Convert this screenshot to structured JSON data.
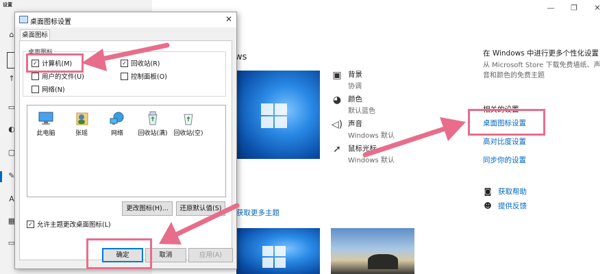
{
  "app": {
    "title": "设置"
  },
  "window_controls": {
    "minimize": "—",
    "maximize": "❐",
    "close": "✕"
  },
  "sidebar": {
    "icons": [
      "home-icon",
      "search-icon",
      "back-icon",
      "background-icon",
      "colors-icon",
      "lockscreen-icon",
      "themes-icon",
      "fonts-icon",
      "start-icon",
      "taskbar-icon"
    ]
  },
  "main": {
    "heading_partial": "ws",
    "themes": [
      {
        "icon": "picture-icon",
        "name": "背景",
        "value": "协调"
      },
      {
        "icon": "palette-icon",
        "name": "颜色",
        "value": "默认蓝色"
      },
      {
        "icon": "volume-icon",
        "name": "声音",
        "value": "Windows 默认"
      },
      {
        "icon": "cursor-icon",
        "name": "鼠标光标",
        "value": "Windows 默认"
      }
    ],
    "store_link_partial": "获取更多主题"
  },
  "right_panel": {
    "heading": "在 Windows 中进行更多个性化设置",
    "description": "从 Microsoft Store 下载免费墙纸、声音和颜色的免费主题",
    "related_heading": "相关的设置",
    "links": [
      "桌面图标设置",
      "高对比度设置",
      "同步你的设置"
    ],
    "help": [
      {
        "icon": "help-chat-icon",
        "label": "获取帮助"
      },
      {
        "icon": "feedback-icon",
        "label": "提供反馈"
      }
    ]
  },
  "dialog": {
    "title": "桌面图标设置",
    "tab": "桌面图标",
    "group_label": "桌面图标",
    "checkboxes": [
      {
        "label": "计算机(M)",
        "checked": true
      },
      {
        "label": "回收站(R)",
        "checked": true
      },
      {
        "label": "用户的文件(U)",
        "checked": false
      },
      {
        "label": "控制面板(O)",
        "checked": false
      },
      {
        "label": "网络(N)",
        "checked": false
      }
    ],
    "icons": [
      {
        "icon": "computer-icon",
        "label": "此电脑"
      },
      {
        "icon": "user-folder-icon",
        "label": "张瑶"
      },
      {
        "icon": "network-icon",
        "label": "网络"
      },
      {
        "icon": "recycle-bin-full-icon",
        "label": "回收站(满)"
      },
      {
        "icon": "recycle-bin-empty-icon",
        "label": "回收站(空)"
      }
    ],
    "change_icon_button": "更改图标(H)...",
    "restore_default_button": "还原默认值(S)",
    "allow_themes": {
      "label": "允许主题更改桌面图标(L)",
      "checked": true
    },
    "ok_button": "确定",
    "cancel_button": "取消",
    "apply_button": "应用(A)"
  },
  "colors": {
    "annotation": "#e86d8b",
    "accent": "#0067c0"
  }
}
